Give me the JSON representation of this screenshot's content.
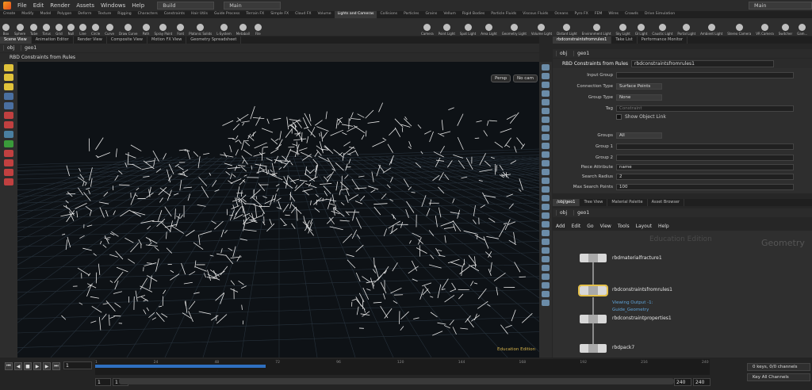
{
  "menubar": {
    "items": [
      "File",
      "Edit",
      "Render",
      "Assets",
      "Windows",
      "Help"
    ],
    "desk_build": "Build",
    "desk_main": "Main",
    "right_desk": "Main"
  },
  "shelf_tabs": [
    "Create",
    "Modify",
    "Model",
    "Polygon",
    "Deform",
    "Texture",
    "Rigging",
    "Characters",
    "Constraints",
    "Hair Utils",
    "Guide Process",
    "Terrain FX",
    "Simple FX",
    "Cloud FX",
    "Volume",
    "Lights and Cameras",
    "Collisions",
    "Particles",
    "Grains",
    "Vellum",
    "Rigid Bodies",
    "Particle Fluids",
    "Viscous Fluids",
    "Oceans",
    "Pyro FX",
    "FEM",
    "Wires",
    "Crowds",
    "Drive Simulation"
  ],
  "shelf_tools_left": [
    "Box",
    "Sphere",
    "Tube",
    "Torus",
    "Grid",
    "Null",
    "Line",
    "Circle",
    "Curve",
    "Draw Curve",
    "Path",
    "Spray Paint",
    "Font",
    "Platonic Solids",
    "L-System",
    "Metaball",
    "File"
  ],
  "shelf_tools_right": [
    "Camera",
    "Point Light",
    "Spot Light",
    "Area Light",
    "Geometry Light",
    "Volume Light",
    "Distant Light",
    "Environment Light",
    "Sky Light",
    "GI Light",
    "Caustic Light",
    "Portal Light",
    "Ambient Light",
    "Stereo Camera",
    "VR Camera",
    "Switcher",
    "Gam..."
  ],
  "left_pane_tabs": [
    "Scene View",
    "Animation Editor",
    "Render View",
    "Composite View",
    "Motion FX View",
    "Geometry Spreadsheet"
  ],
  "right_pane_tabs": [
    "rbdconstraintsfromrules1",
    "Take List",
    "Performance Monitor"
  ],
  "net_pane_tabs": [
    "/obj/geo1",
    "Tree View",
    "Material Palette",
    "Asset Browser"
  ],
  "path": {
    "obj": "obj",
    "geo": "geo1"
  },
  "viewport": {
    "title": "RBD Constraints from Rules",
    "persp": "Persp",
    "cam": "No cam",
    "edu": "Education Edition"
  },
  "node_header": {
    "type": "RBD Constraints from Rules",
    "name": "rbdconstraintsfromrules1"
  },
  "params": [
    {
      "label": "Input Group",
      "value": ""
    },
    {
      "label": "Connection Type",
      "value": "Surface Points"
    },
    {
      "label": "Group Type",
      "value": "None"
    },
    {
      "label": "Tag",
      "value": "Constraint"
    },
    {
      "label": "",
      "value": "Show Object Link"
    },
    {
      "label": "Groups",
      "value": "All"
    },
    {
      "label": "Group 1",
      "value": ""
    },
    {
      "label": "Group 2",
      "value": ""
    },
    {
      "label": "Piece Attribute",
      "value": "name"
    },
    {
      "label": "Search Radius",
      "value": "2"
    },
    {
      "label": "Max Search Points",
      "value": "100"
    }
  ],
  "net_menu": [
    "Add",
    "Edit",
    "Go",
    "View",
    "Tools",
    "Layout",
    "Help"
  ],
  "net": {
    "watermark1": "Education Edition",
    "watermark2": "Geometry",
    "nodes": [
      {
        "name": "rbdmaterialfracture1",
        "sub": ""
      },
      {
        "name": "rbdconstraintsfromrules1",
        "sub": "Viewing Output -1:"
      },
      {
        "name": "rbdconstraintproperties1",
        "sub": ""
      },
      {
        "name": "rbdpack7",
        "sub": ""
      }
    ],
    "guide": "Guide_Geometry"
  },
  "timeline": {
    "frame": "1",
    "ticks": [
      "1",
      "24",
      "48",
      "72",
      "96",
      "120",
      "144",
      "168",
      "192",
      "216",
      "240"
    ],
    "start": "1",
    "start2": "1",
    "end": "240",
    "end2": "240",
    "keys": "0 keys, 0/0 channels",
    "key_all": "Key All Channels"
  },
  "colors": {
    "accent": "#2f6fbf",
    "selected_node": "#e4c04a",
    "edu": "#d4b24a"
  }
}
